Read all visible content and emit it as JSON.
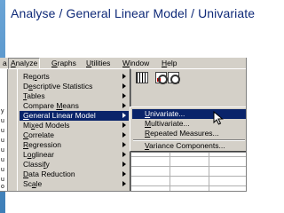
{
  "slide": {
    "title": "Analyse / General Linear Model / Univariate"
  },
  "menubar": {
    "items": [
      {
        "pre": "",
        "ul": "",
        "post": "a"
      },
      {
        "pre": "",
        "ul": "A",
        "post": "nalyze"
      },
      {
        "pre": "",
        "ul": "G",
        "post": "raphs"
      },
      {
        "pre": "",
        "ul": "U",
        "post": "tilities"
      },
      {
        "pre": "",
        "ul": "W",
        "post": "indow"
      },
      {
        "pre": "",
        "ul": "H",
        "post": "elp"
      }
    ]
  },
  "left_column": [
    "y",
    "u",
    "u",
    "u",
    "u",
    "u",
    "u",
    "u",
    "o",
    "o"
  ],
  "analyze_menu": {
    "items": [
      {
        "pre": "Re",
        "ul": "p",
        "post": "orts",
        "submenu": true
      },
      {
        "pre": "D",
        "ul": "e",
        "post": "scriptive Statistics",
        "submenu": true
      },
      {
        "pre": "",
        "ul": "T",
        "post": "ables",
        "submenu": true
      },
      {
        "pre": "Compare ",
        "ul": "M",
        "post": "eans",
        "submenu": true
      },
      {
        "pre": "",
        "ul": "G",
        "post": "eneral Linear Model",
        "submenu": true
      },
      {
        "pre": "Mi",
        "ul": "x",
        "post": "ed Models",
        "submenu": true
      },
      {
        "pre": "",
        "ul": "C",
        "post": "orrelate",
        "submenu": true
      },
      {
        "pre": "",
        "ul": "R",
        "post": "egression",
        "submenu": true
      },
      {
        "pre": "L",
        "ul": "o",
        "post": "glinear",
        "submenu": true
      },
      {
        "pre": "Classi",
        "ul": "f",
        "post": "y",
        "submenu": true
      },
      {
        "pre": "",
        "ul": "D",
        "post": "ata Reduction",
        "submenu": true
      },
      {
        "pre": "Sc",
        "ul": "a",
        "post": "le",
        "submenu": true
      }
    ],
    "highlighted_index": 4
  },
  "glm_submenu": {
    "items": [
      {
        "pre": "",
        "ul": "U",
        "post": "nivariate..."
      },
      {
        "pre": "",
        "ul": "M",
        "post": "ultivariate..."
      },
      {
        "pre": "",
        "ul": "R",
        "post": "epeated Measures..."
      },
      {
        "pre": "",
        "ul": "V",
        "post": "ariance Components..."
      }
    ],
    "highlighted_index": 0
  },
  "colors": {
    "menu_highlight": "#0a246a",
    "title_text": "#0f2a78",
    "chrome": "#d4d0c8"
  }
}
